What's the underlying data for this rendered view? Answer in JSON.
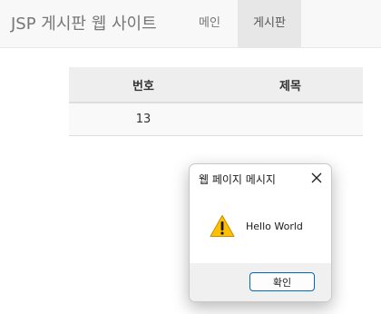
{
  "navbar": {
    "brand": "JSP 게시판 웹 사이트",
    "items": [
      {
        "label": "메인",
        "active": false
      },
      {
        "label": "게시판",
        "active": true
      }
    ]
  },
  "table": {
    "headers": [
      "번호",
      "제목"
    ],
    "rows": [
      [
        "13",
        ""
      ]
    ]
  },
  "dialog": {
    "title": "웹 페이지 메시지",
    "close_icon": "close-icon",
    "icon": "warning-icon",
    "message": "Hello World",
    "ok_label": "확인"
  },
  "colors": {
    "navbar_bg": "#f8f8f8",
    "active_nav_bg": "#e7e7e7",
    "warning_yellow": "#ffc000",
    "button_border": "#0067c0"
  }
}
